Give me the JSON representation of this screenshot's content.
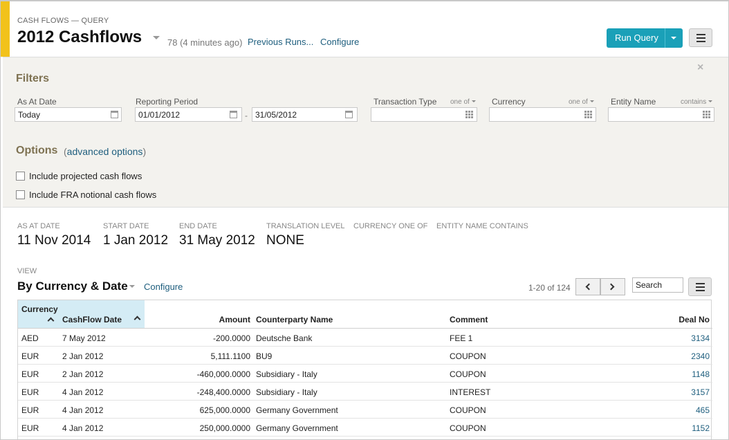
{
  "header": {
    "crumb": "CASH FLOWS — QUERY",
    "title": "2012 Cashflows",
    "run_info": "78 (4 minutes ago)",
    "previous_runs": "Previous Runs...",
    "configure": "Configure",
    "run_query": "Run Query"
  },
  "filters": {
    "title": "Filters",
    "close": "×",
    "as_at_label": "As At Date",
    "as_at_value": "Today",
    "period_label": "Reporting Period",
    "period_from": "01/01/2012",
    "period_dash": "-",
    "period_to": "31/05/2012",
    "txn_label": "Transaction Type",
    "txn_mod": "one of",
    "ccy_label": "Currency",
    "ccy_mod": "one of",
    "entity_label": "Entity Name",
    "entity_mod": "contains"
  },
  "options": {
    "title": "Options",
    "adv_open": "(",
    "adv_link": "advanced options",
    "adv_close": ")",
    "projected": "Include projected cash flows",
    "fra": "Include FRA notional cash flows"
  },
  "summary": {
    "as_at_label": "AS AT DATE",
    "as_at": "11 Nov 2014",
    "start_label": "START DATE",
    "start": "1 Jan 2012",
    "end_label": "END DATE",
    "end": "31 May 2012",
    "trans_label": "TRANSLATION LEVEL",
    "trans": "NONE",
    "ccy_label": "CURRENCY ONE OF",
    "entity_label": "ENTITY NAME CONTAINS"
  },
  "view": {
    "label": "VIEW",
    "title": "By Currency & Date",
    "configure": "Configure",
    "paging": "1-20 of 124",
    "search": "Search"
  },
  "table": {
    "group": "Currency",
    "cols": {
      "date": "CashFlow Date",
      "amount": "Amount",
      "cpty": "Counterparty Name",
      "comment": "Comment",
      "deal": "Deal No"
    },
    "rows": [
      {
        "ccy": "AED",
        "date": "7 May 2012",
        "amount": "-200.0000",
        "cpty": "Deutsche Bank",
        "comment": "FEE 1",
        "deal": "3134"
      },
      {
        "ccy": "EUR",
        "date": "2 Jan 2012",
        "amount": "5,111.1100",
        "cpty": "BU9",
        "comment": "COUPON",
        "deal": "2340"
      },
      {
        "ccy": "EUR",
        "date": "2 Jan 2012",
        "amount": "-460,000.0000",
        "cpty": "Subsidiary - Italy",
        "comment": "COUPON",
        "deal": "1148"
      },
      {
        "ccy": "EUR",
        "date": "4 Jan 2012",
        "amount": "-248,400.0000",
        "cpty": "Subsidiary - Italy",
        "comment": "INTEREST",
        "deal": "3157"
      },
      {
        "ccy": "EUR",
        "date": "4 Jan 2012",
        "amount": "625,000.0000",
        "cpty": "Germany Government",
        "comment": "COUPON",
        "deal": "465"
      },
      {
        "ccy": "EUR",
        "date": "4 Jan 2012",
        "amount": "250,000.0000",
        "cpty": "Germany Government",
        "comment": "COUPON",
        "deal": "1152"
      }
    ]
  },
  "colors": {
    "accent": "#f2c21b",
    "primary": "#1aa0b8",
    "link": "#1e5e7e",
    "section_title": "#7e7252",
    "filter_bg": "#f3f2ee",
    "group_header_bg": "#d4ecf5"
  },
  "icons": [
    "title-caret-icon",
    "dropdown-caret-icon",
    "hamburger-menu-icon",
    "close-icon",
    "calendar-icon",
    "multi-select-grid-icon",
    "sort-ascending-icon",
    "chevron-left-icon",
    "chevron-right-icon"
  ]
}
